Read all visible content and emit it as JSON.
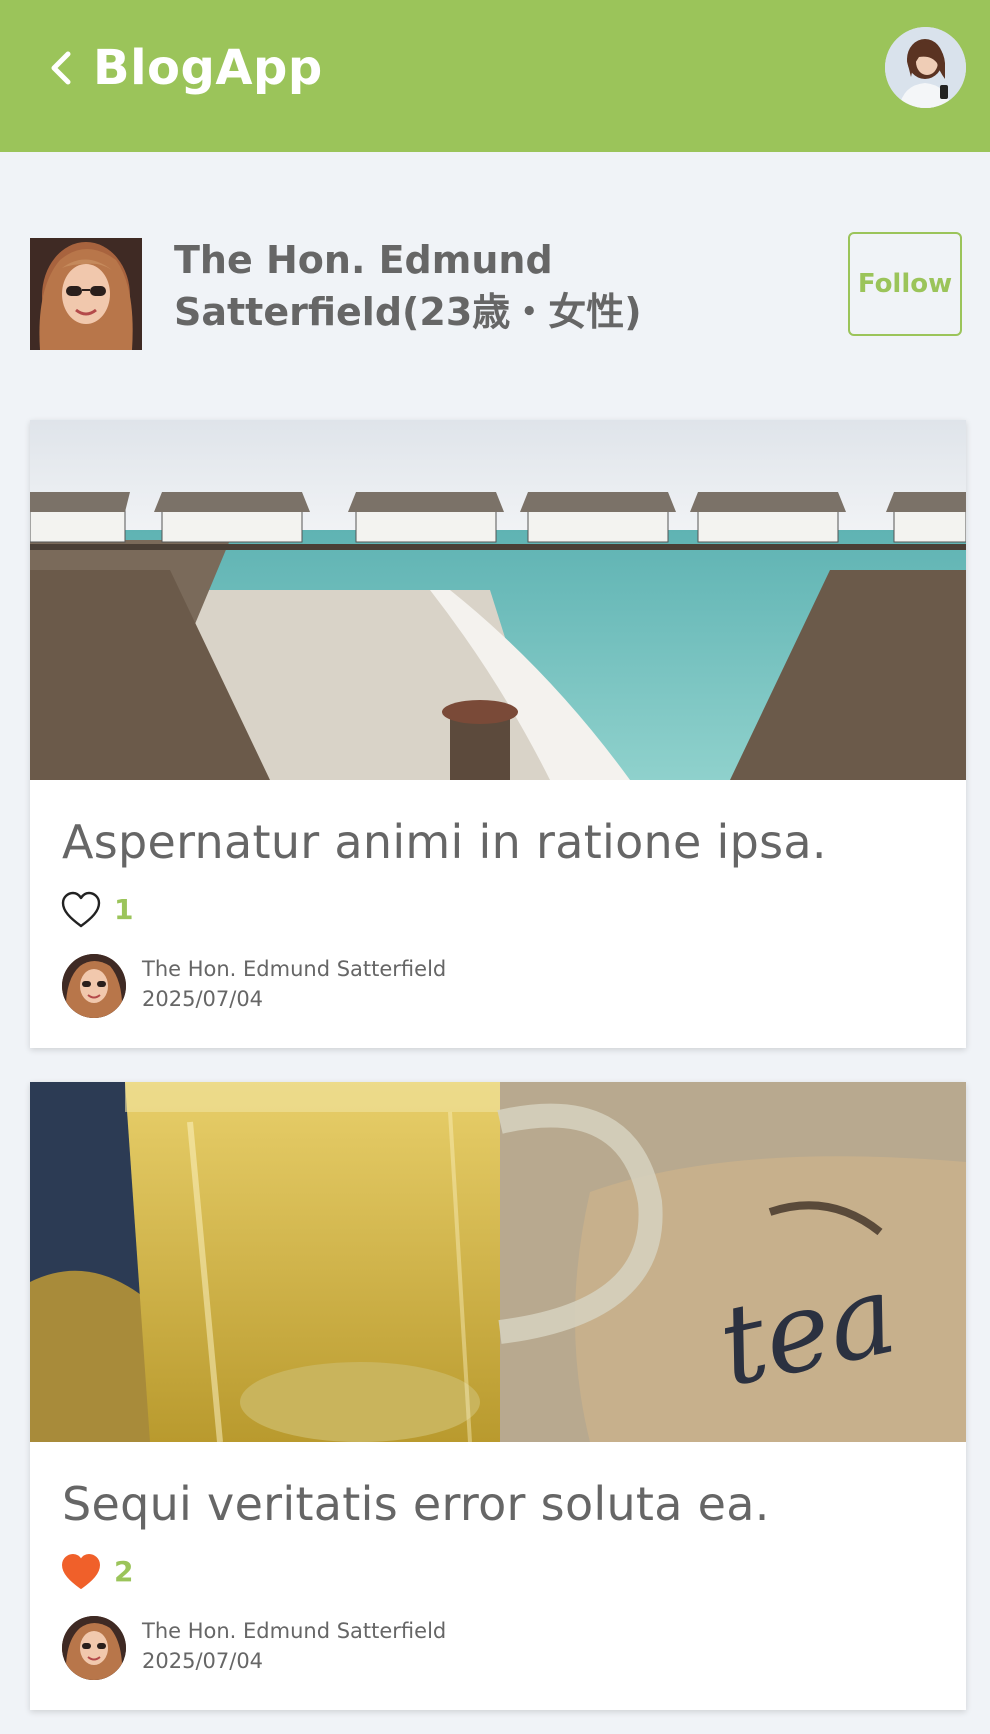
{
  "app_bar": {
    "title": "BlogApp",
    "background_color": "#9bc45a",
    "back_icon": "chevron-left-icon",
    "avatar_icon": "user-avatar"
  },
  "profile": {
    "name": "The Hon. Edmund Satterfield(23歳・女性)",
    "follow_label": "Follow",
    "accent_color": "#9bc45a"
  },
  "posts": [
    {
      "title": "Aspernatur animi in ratione ipsa.",
      "image": "overwater-bungalows-beach-photo",
      "liked": false,
      "like_icon": "heart-outline-icon",
      "like_count": "1",
      "author": "The Hon. Edmund Satterfield",
      "date": "2025/07/04"
    },
    {
      "title": "Sequi veritatis error soluta ea.",
      "image": "glass-of-tea-and-burlap-bag-photo",
      "liked": true,
      "like_icon": "heart-filled-icon",
      "like_color": "#f0602a",
      "like_count": "2",
      "author": "The Hon. Edmund Satterfield",
      "date": "2025/07/04"
    }
  ]
}
